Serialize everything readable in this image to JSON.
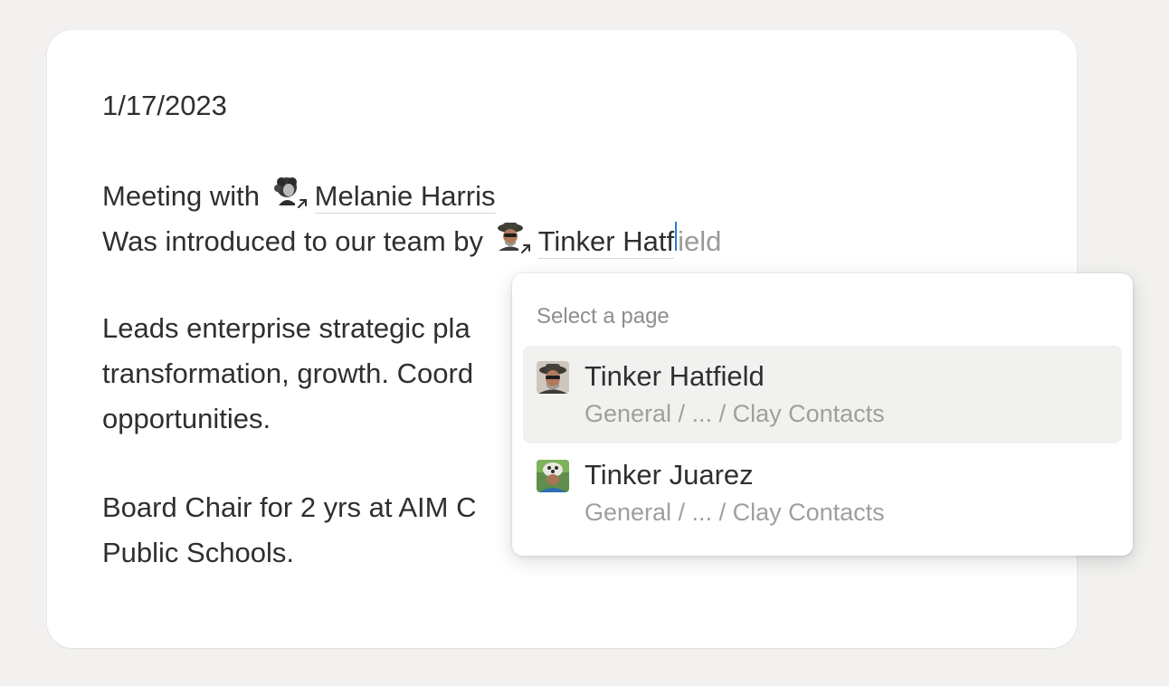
{
  "document": {
    "date": "1/17/2023",
    "meeting_prefix": "Meeting with",
    "meeting_person": "Melanie Harris",
    "intro_prefix": "Was introduced to our team by",
    "intro_typed": "Tinker Hatf",
    "intro_ghost": "ield",
    "para1_line1": "Leads enterprise strategic pla",
    "para1_line2": "transformation, growth. Coord",
    "para1_line3": "opportunities.",
    "para2_line1": "Board Chair for 2 yrs at AIM C",
    "para2_line2": "Public Schools."
  },
  "dropdown": {
    "header": "Select a page",
    "items": [
      {
        "title": "Tinker Hatfield",
        "path": "General / ... / Clay Contacts",
        "selected": true,
        "icon": "avatar-photo-icon"
      },
      {
        "title": "Tinker Juarez",
        "path": "General / ... / Clay Contacts",
        "selected": false,
        "icon": "avatar-photo-icon"
      }
    ]
  },
  "colors": {
    "background": "#f2f1ef",
    "card": "#ffffff",
    "text": "#2f2f2f",
    "muted": "#a09f9c",
    "caret": "#2a7bd6",
    "selected_row": "#f1f1ef"
  }
}
